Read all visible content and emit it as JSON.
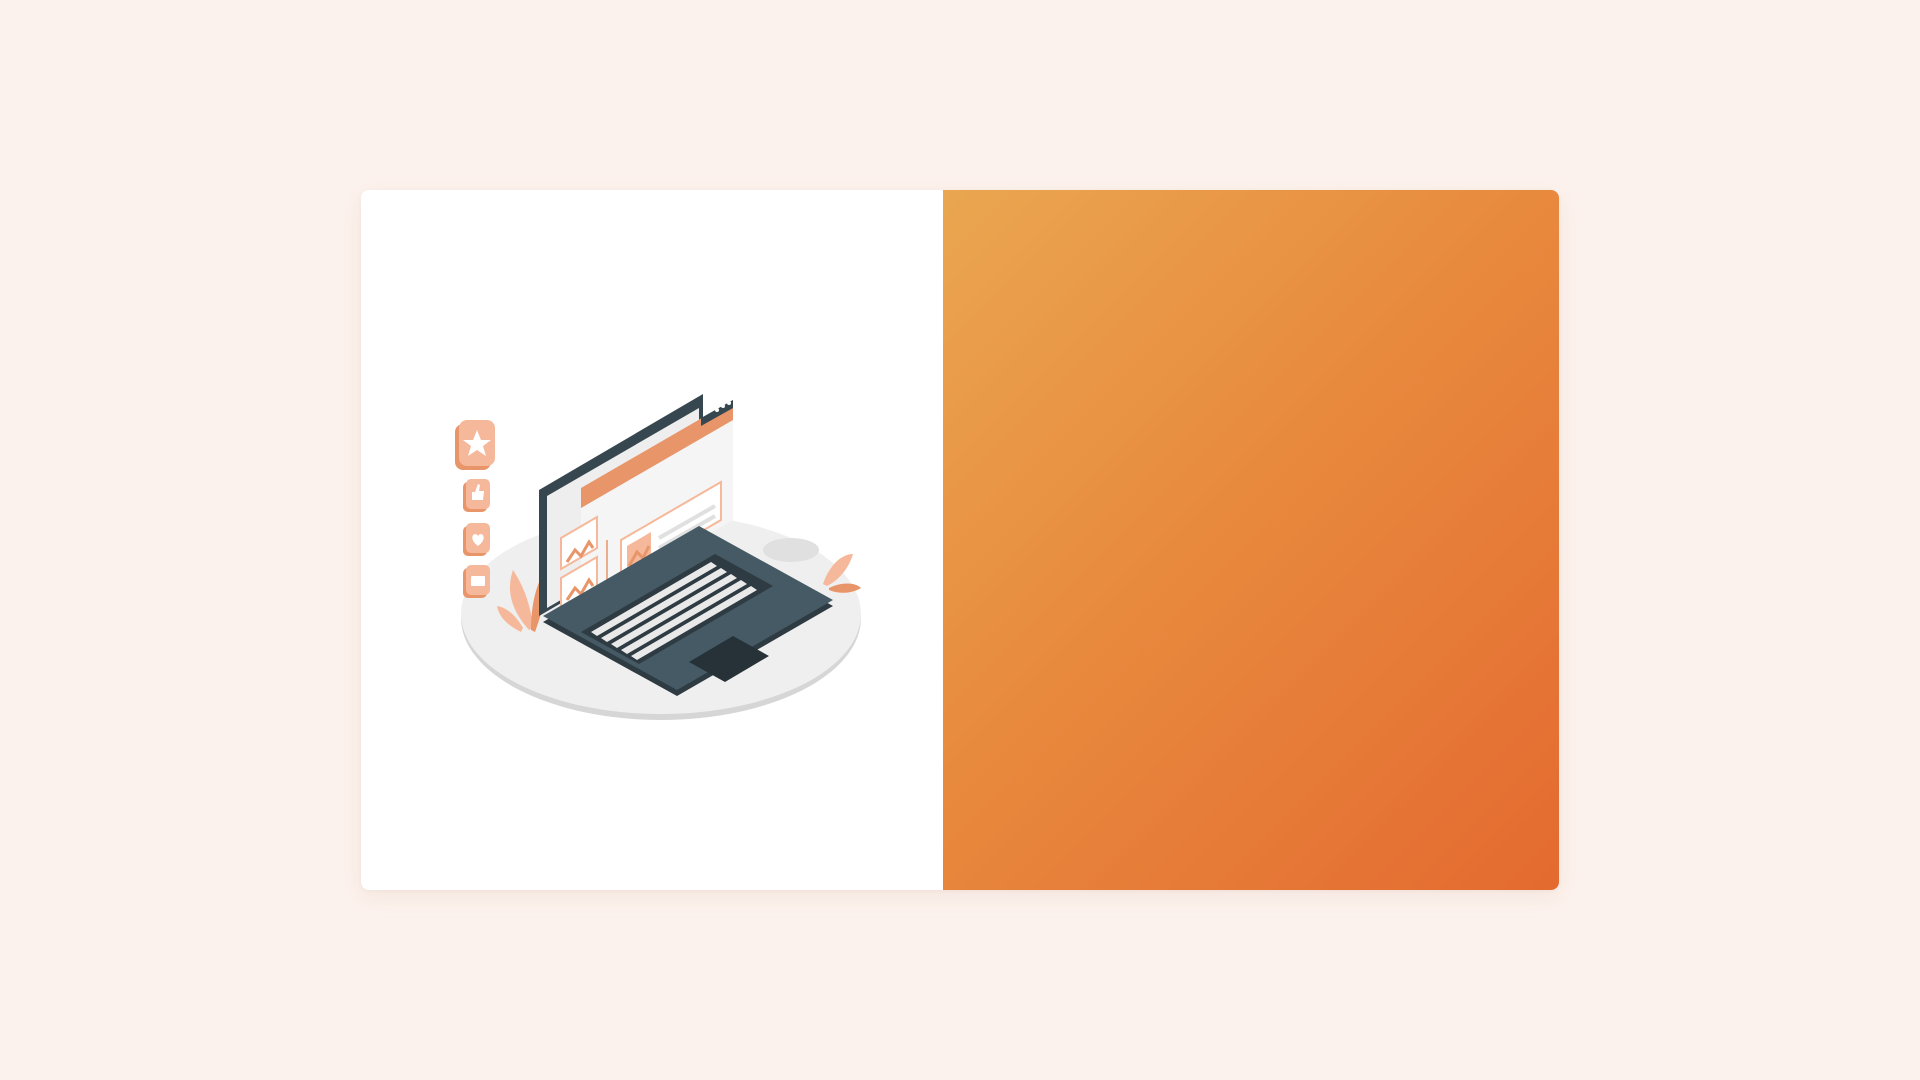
{
  "page": {
    "background": "#fcf2ed"
  },
  "card": {
    "left_panel": {
      "background": "#ffffff",
      "illustration": {
        "subject": "laptop-with-web-page",
        "icons": [
          "star-icon",
          "thumbs-up-icon",
          "heart-icon",
          "video-icon"
        ],
        "colors": {
          "dark": "#37474f",
          "accent": "#e8956a",
          "light_accent": "#f6b89a",
          "platform": "#ebebeb",
          "screen": "#f5f5f5"
        }
      }
    },
    "right_panel": {
      "gradient_start": "#eaa650",
      "gradient_end": "#e46a30"
    }
  }
}
